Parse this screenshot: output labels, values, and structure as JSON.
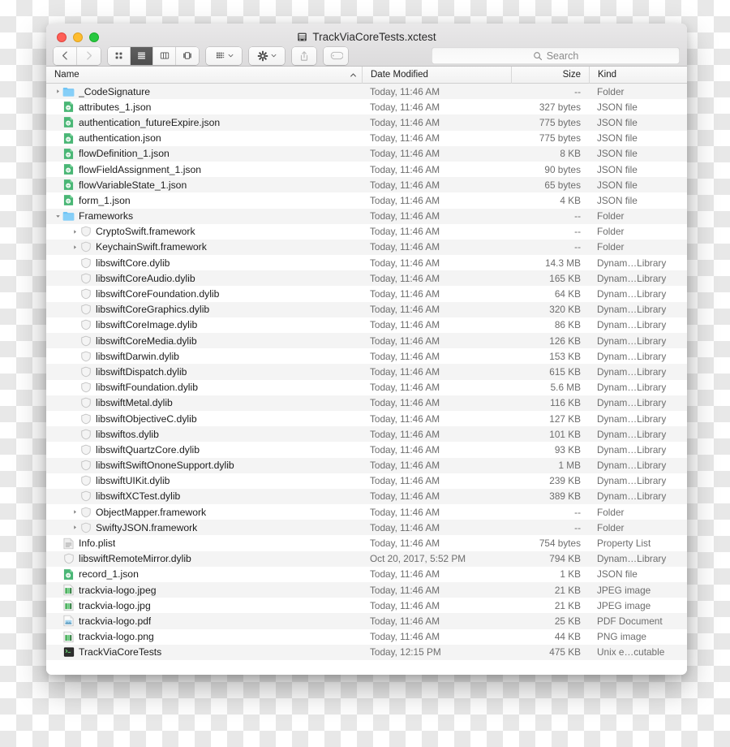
{
  "window": {
    "title": "TrackViaCoreTests.xctest",
    "title_icon": "xctest-bundle-icon",
    "traffic_lights": [
      "close-button",
      "minimize-button",
      "zoom-button"
    ],
    "colors": {
      "red": "#ff5f57",
      "yellow": "#febc2e",
      "green": "#28c840",
      "folder_blue": "#6fc4f5",
      "json_green": "#49b675"
    }
  },
  "toolbar": {
    "back_label": "Back",
    "forward_label": "Forward",
    "view_icon_label": "Icon View",
    "view_list_label": "List View",
    "view_column_label": "Column View",
    "view_gallery_label": "Gallery View",
    "arrange_label": "Arrange By",
    "action_label": "Action",
    "share_label": "Share",
    "tags_label": "Edit Tags",
    "selected_view": "list"
  },
  "search": {
    "placeholder": "Search",
    "value": "",
    "icon": "search-icon"
  },
  "columns": {
    "name": "Name",
    "date_modified": "Date Modified",
    "size": "Size",
    "kind": "Kind",
    "sort_column": "Name",
    "sort_direction": "ascending"
  },
  "files": [
    {
      "name": "_CodeSignature",
      "date": "Today, 11:46 AM",
      "size": "--",
      "kind": "Folder",
      "icon": "folder-icon",
      "indent": 0,
      "disclosure": "collapsed"
    },
    {
      "name": "attributes_1.json",
      "date": "Today, 11:46 AM",
      "size": "327 bytes",
      "kind": "JSON file",
      "icon": "json-file-icon",
      "indent": 0,
      "disclosure": "none"
    },
    {
      "name": "authentication_futureExpire.json",
      "date": "Today, 11:46 AM",
      "size": "775 bytes",
      "kind": "JSON file",
      "icon": "json-file-icon",
      "indent": 0,
      "disclosure": "none"
    },
    {
      "name": "authentication.json",
      "date": "Today, 11:46 AM",
      "size": "775 bytes",
      "kind": "JSON file",
      "icon": "json-file-icon",
      "indent": 0,
      "disclosure": "none"
    },
    {
      "name": "flowDefinition_1.json",
      "date": "Today, 11:46 AM",
      "size": "8 KB",
      "kind": "JSON file",
      "icon": "json-file-icon",
      "indent": 0,
      "disclosure": "none"
    },
    {
      "name": "flowFieldAssignment_1.json",
      "date": "Today, 11:46 AM",
      "size": "90 bytes",
      "kind": "JSON file",
      "icon": "json-file-icon",
      "indent": 0,
      "disclosure": "none"
    },
    {
      "name": "flowVariableState_1.json",
      "date": "Today, 11:46 AM",
      "size": "65 bytes",
      "kind": "JSON file",
      "icon": "json-file-icon",
      "indent": 0,
      "disclosure": "none"
    },
    {
      "name": "form_1.json",
      "date": "Today, 11:46 AM",
      "size": "4 KB",
      "kind": "JSON file",
      "icon": "json-file-icon",
      "indent": 0,
      "disclosure": "none"
    },
    {
      "name": "Frameworks",
      "date": "Today, 11:46 AM",
      "size": "--",
      "kind": "Folder",
      "icon": "folder-icon",
      "indent": 0,
      "disclosure": "expanded"
    },
    {
      "name": "CryptoSwift.framework",
      "date": "Today, 11:46 AM",
      "size": "--",
      "kind": "Folder",
      "icon": "framework-icon",
      "indent": 1,
      "disclosure": "collapsed"
    },
    {
      "name": "KeychainSwift.framework",
      "date": "Today, 11:46 AM",
      "size": "--",
      "kind": "Folder",
      "icon": "framework-icon",
      "indent": 1,
      "disclosure": "collapsed"
    },
    {
      "name": "libswiftCore.dylib",
      "date": "Today, 11:46 AM",
      "size": "14.3 MB",
      "kind": "Dynam…Library",
      "icon": "dylib-icon",
      "indent": 1,
      "disclosure": "none"
    },
    {
      "name": "libswiftCoreAudio.dylib",
      "date": "Today, 11:46 AM",
      "size": "165 KB",
      "kind": "Dynam…Library",
      "icon": "dylib-icon",
      "indent": 1,
      "disclosure": "none"
    },
    {
      "name": "libswiftCoreFoundation.dylib",
      "date": "Today, 11:46 AM",
      "size": "64 KB",
      "kind": "Dynam…Library",
      "icon": "dylib-icon",
      "indent": 1,
      "disclosure": "none"
    },
    {
      "name": "libswiftCoreGraphics.dylib",
      "date": "Today, 11:46 AM",
      "size": "320 KB",
      "kind": "Dynam…Library",
      "icon": "dylib-icon",
      "indent": 1,
      "disclosure": "none"
    },
    {
      "name": "libswiftCoreImage.dylib",
      "date": "Today, 11:46 AM",
      "size": "86 KB",
      "kind": "Dynam…Library",
      "icon": "dylib-icon",
      "indent": 1,
      "disclosure": "none"
    },
    {
      "name": "libswiftCoreMedia.dylib",
      "date": "Today, 11:46 AM",
      "size": "126 KB",
      "kind": "Dynam…Library",
      "icon": "dylib-icon",
      "indent": 1,
      "disclosure": "none"
    },
    {
      "name": "libswiftDarwin.dylib",
      "date": "Today, 11:46 AM",
      "size": "153 KB",
      "kind": "Dynam…Library",
      "icon": "dylib-icon",
      "indent": 1,
      "disclosure": "none"
    },
    {
      "name": "libswiftDispatch.dylib",
      "date": "Today, 11:46 AM",
      "size": "615 KB",
      "kind": "Dynam…Library",
      "icon": "dylib-icon",
      "indent": 1,
      "disclosure": "none"
    },
    {
      "name": "libswiftFoundation.dylib",
      "date": "Today, 11:46 AM",
      "size": "5.6 MB",
      "kind": "Dynam…Library",
      "icon": "dylib-icon",
      "indent": 1,
      "disclosure": "none"
    },
    {
      "name": "libswiftMetal.dylib",
      "date": "Today, 11:46 AM",
      "size": "116 KB",
      "kind": "Dynam…Library",
      "icon": "dylib-icon",
      "indent": 1,
      "disclosure": "none"
    },
    {
      "name": "libswiftObjectiveC.dylib",
      "date": "Today, 11:46 AM",
      "size": "127 KB",
      "kind": "Dynam…Library",
      "icon": "dylib-icon",
      "indent": 1,
      "disclosure": "none"
    },
    {
      "name": "libswiftos.dylib",
      "date": "Today, 11:46 AM",
      "size": "101 KB",
      "kind": "Dynam…Library",
      "icon": "dylib-icon",
      "indent": 1,
      "disclosure": "none"
    },
    {
      "name": "libswiftQuartzCore.dylib",
      "date": "Today, 11:46 AM",
      "size": "93 KB",
      "kind": "Dynam…Library",
      "icon": "dylib-icon",
      "indent": 1,
      "disclosure": "none"
    },
    {
      "name": "libswiftSwiftOnoneSupport.dylib",
      "date": "Today, 11:46 AM",
      "size": "1 MB",
      "kind": "Dynam…Library",
      "icon": "dylib-icon",
      "indent": 1,
      "disclosure": "none"
    },
    {
      "name": "libswiftUIKit.dylib",
      "date": "Today, 11:46 AM",
      "size": "239 KB",
      "kind": "Dynam…Library",
      "icon": "dylib-icon",
      "indent": 1,
      "disclosure": "none"
    },
    {
      "name": "libswiftXCTest.dylib",
      "date": "Today, 11:46 AM",
      "size": "389 KB",
      "kind": "Dynam…Library",
      "icon": "dylib-icon",
      "indent": 1,
      "disclosure": "none"
    },
    {
      "name": "ObjectMapper.framework",
      "date": "Today, 11:46 AM",
      "size": "--",
      "kind": "Folder",
      "icon": "framework-icon",
      "indent": 1,
      "disclosure": "collapsed"
    },
    {
      "name": "SwiftyJSON.framework",
      "date": "Today, 11:46 AM",
      "size": "--",
      "kind": "Folder",
      "icon": "framework-icon",
      "indent": 1,
      "disclosure": "collapsed"
    },
    {
      "name": "Info.plist",
      "date": "Today, 11:46 AM",
      "size": "754 bytes",
      "kind": "Property List",
      "icon": "plist-file-icon",
      "indent": 0,
      "disclosure": "none"
    },
    {
      "name": "libswiftRemoteMirror.dylib",
      "date": "Oct 20, 2017, 5:52 PM",
      "size": "794 KB",
      "kind": "Dynam…Library",
      "icon": "dylib-icon",
      "indent": 0,
      "disclosure": "none"
    },
    {
      "name": "record_1.json",
      "date": "Today, 11:46 AM",
      "size": "1 KB",
      "kind": "JSON file",
      "icon": "json-file-icon",
      "indent": 0,
      "disclosure": "none"
    },
    {
      "name": "trackvia-logo.jpeg",
      "date": "Today, 11:46 AM",
      "size": "21 KB",
      "kind": "JPEG image",
      "icon": "image-file-icon",
      "indent": 0,
      "disclosure": "none"
    },
    {
      "name": "trackvia-logo.jpg",
      "date": "Today, 11:46 AM",
      "size": "21 KB",
      "kind": "JPEG image",
      "icon": "image-file-icon",
      "indent": 0,
      "disclosure": "none"
    },
    {
      "name": "trackvia-logo.pdf",
      "date": "Today, 11:46 AM",
      "size": "25 KB",
      "kind": "PDF Document",
      "icon": "pdf-file-icon",
      "indent": 0,
      "disclosure": "none"
    },
    {
      "name": "trackvia-logo.png",
      "date": "Today, 11:46 AM",
      "size": "44 KB",
      "kind": "PNG image",
      "icon": "image-file-icon",
      "indent": 0,
      "disclosure": "none"
    },
    {
      "name": "TrackViaCoreTests",
      "date": "Today, 12:15 PM",
      "size": "475 KB",
      "kind": "Unix e…cutable",
      "icon": "unix-executable-icon",
      "indent": 0,
      "disclosure": "none"
    }
  ]
}
